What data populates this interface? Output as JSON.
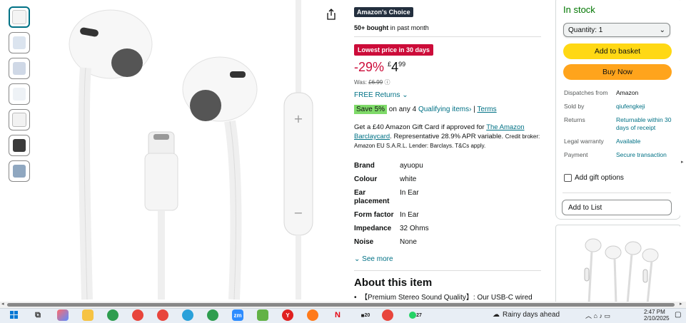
{
  "colors": {
    "accent": "#007185",
    "deal": "#cc0c39",
    "stock": "#007600",
    "basket": "#ffd814",
    "buy": "#ffa41c"
  },
  "product": {
    "choice_badge": "Amazon's Choice",
    "bought_bold": "50+ bought",
    "bought_rest": " in past month",
    "deal_badge": "Lowest price in 30 days",
    "discount": "-29%",
    "currency": "£",
    "price_whole": "4",
    "price_fraction": "99",
    "was_label": "Was:",
    "was_price": "£6.99",
    "free_returns": "FREE Returns",
    "save_badge": "Save 5%",
    "save_rest": " on any 4 ",
    "qualifying": "Qualifying items",
    "qualifying_sep": " | ",
    "terms": "Terms",
    "giftcard_text1": "Get a £40 Amazon Gift Card if approved for ",
    "giftcard_link": "The Amazon Barclaycard",
    "giftcard_text2": ". Representative 28.9% APR variable. ",
    "giftcard_small": "Credit broker: Amazon EU S.A.R.L. Lender: Barclays. T&Cs apply.",
    "specs": [
      {
        "k": "Brand",
        "v": "ayuopu"
      },
      {
        "k": "Colour",
        "v": "white"
      },
      {
        "k": "Ear placement",
        "v": "In Ear"
      },
      {
        "k": "Form factor",
        "v": "In Ear"
      },
      {
        "k": "Impedance",
        "v": "32 Ohms"
      },
      {
        "k": "Noise",
        "v": "None"
      }
    ],
    "see_more": "See more",
    "about_title": "About this item",
    "bullet1": "【Premium Stereo Sound Quality】: Our USB-C wired"
  },
  "buybox": {
    "in_stock": "In stock",
    "quantity": "Quantity: 1",
    "add_to_basket": "Add to basket",
    "buy_now": "Buy Now",
    "info": [
      {
        "k": "Dispatches from",
        "v": "Amazon",
        "link": false
      },
      {
        "k": "Sold by",
        "v": "qiufengkeji",
        "link": true
      },
      {
        "k": "Returns",
        "v": "Returnable within 30 days of receipt",
        "link": true
      },
      {
        "k": "Legal warranty",
        "v": "Available",
        "link": true
      },
      {
        "k": "Payment",
        "v": "Secure transaction",
        "link": true
      }
    ],
    "add_gift": "Add gift options",
    "add_to_list": "Add to List"
  },
  "taskbar": {
    "weather": "Rainy days ahead",
    "time": "2:47 PM",
    "date": "2/10/2025",
    "badges": {
      "teams": "20",
      "whatsapp": "27"
    }
  }
}
